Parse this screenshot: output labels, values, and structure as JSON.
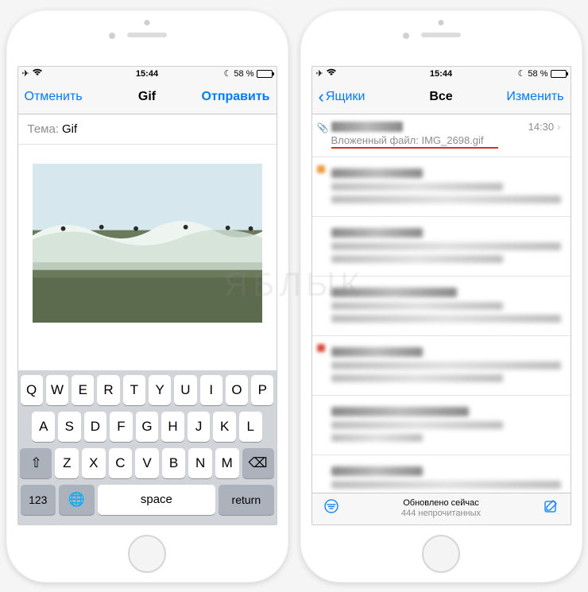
{
  "status": {
    "time": "15:44",
    "battery_pct": "58 %"
  },
  "left": {
    "nav": {
      "cancel": "Отменить",
      "title": "Gif",
      "send": "Отправить"
    },
    "subject": {
      "label": "Тема:",
      "value": "Gif"
    },
    "keyboard": {
      "row1": [
        "Q",
        "W",
        "E",
        "R",
        "T",
        "Y",
        "U",
        "I",
        "O",
        "P"
      ],
      "row2": [
        "A",
        "S",
        "D",
        "F",
        "G",
        "H",
        "J",
        "K",
        "L"
      ],
      "row3": [
        "Z",
        "X",
        "C",
        "V",
        "B",
        "N",
        "M"
      ],
      "shift": "⇧",
      "backspace": "⌫",
      "num": "123",
      "globe": "🌐",
      "space": "space",
      "return": "return"
    }
  },
  "right": {
    "nav": {
      "back": "Ящики",
      "title": "Все",
      "edit": "Изменить"
    },
    "first_mail": {
      "time": "14:30",
      "preview": "Вложенный файл: IMG_2698.gif"
    },
    "toolbar": {
      "updated": "Обновлено сейчас",
      "unread": "444 непрочитанных"
    }
  },
  "watermark": "ЯБЛЫК"
}
